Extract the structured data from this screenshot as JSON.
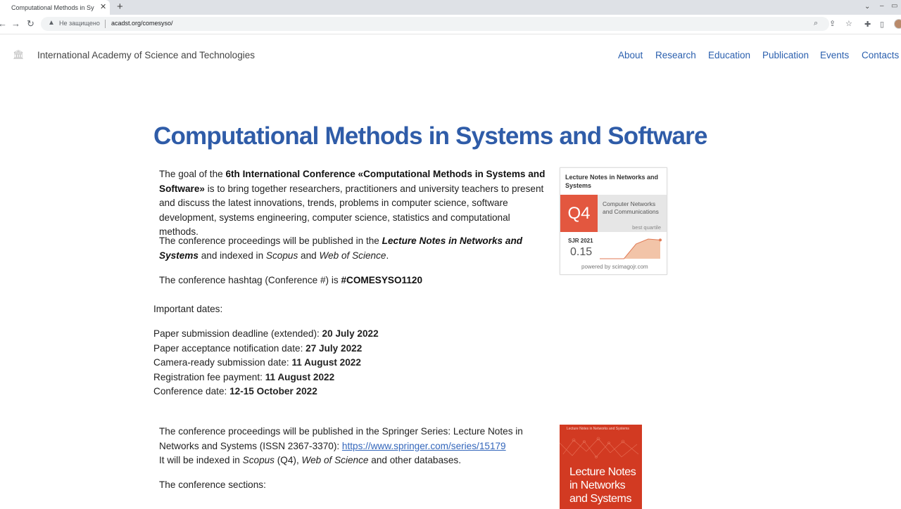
{
  "browser": {
    "tab_title": "Computational Methods in Systems and Software",
    "insecure_label": "Не защищено",
    "url": "acadst.org/comesyso/"
  },
  "site": {
    "name": "International Academy of Science and Technologies",
    "nav": [
      "About",
      "Research",
      "Education",
      "Publication",
      "Events",
      "Contacts"
    ]
  },
  "main": {
    "title": "Computational Methods in Systems and Software",
    "intro": {
      "p1_a": "The goal of the ",
      "p1_bold": "6th International Conference «Computational Methods in Systems and Software»",
      "p1_b": " is to bring together researchers, practitioners and university teachers to present and discuss the latest innovations, trends, problems in computer science, software development, systems engineering, computer science, statistics and computational methods.",
      "p2_a": "The conference proceedings will be published in the ",
      "p2_bold_italic": "Lecture Notes in Networks and Systems",
      "p2_b": " and indexed in ",
      "p2_scopus": "Scopus",
      "p2_c": " and ",
      "p2_wos": "Web of Science",
      "p2_d": ".",
      "p3_a": "The conference hashtag (Conference #) is ",
      "p3_bold": "#COMESYSO1120"
    },
    "important_dates_label": "Important dates:",
    "dates": [
      {
        "label": "Paper submission deadline (extended): ",
        "value": "20 July 2022"
      },
      {
        "label": "Paper acceptance notification date: ",
        "value": "27 July 2022"
      },
      {
        "label": "Camera-ready submission date: ",
        "value": "11 August 2022"
      },
      {
        "label": "Registration fee payment: ",
        "value": "11 August 2022"
      },
      {
        "label": "Conference date: ",
        "value": "12-15 October 2022"
      }
    ],
    "proceedings": {
      "a": "The conference proceedings will be published in the Springer Series: Lecture Notes in Networks and Systems (ISSN 2367-3370): ",
      "link": "https://www.springer.com/series/15179",
      "b": "It will be indexed in ",
      "scopus": "Scopus",
      "c": " (Q4), ",
      "wos": "Web of Science",
      "d": " and other databases."
    },
    "sections_label": "The conference sections:"
  },
  "sjr_badge": {
    "journal": "Lecture Notes in Networks and Systems",
    "quartile": "Q4",
    "category": "Computer Networks and Communications",
    "best_quartile": "best quartile",
    "year_label": "SJR 2021",
    "value": "0.15",
    "powered_by": "powered by scimagojr.com",
    "trend": [
      0,
      0,
      0,
      0.75,
      1,
      0.95
    ],
    "colors": {
      "quartile_bg": "#e3573f",
      "trend_fill": "#f2c4a8",
      "trend_line": "#e07a55"
    }
  },
  "book_cover": {
    "series": "Lecture Notes in Networks and Systems",
    "title_lines": [
      "Lecture Notes",
      "in Networks",
      "and Systems"
    ],
    "color": "#d23a22"
  }
}
